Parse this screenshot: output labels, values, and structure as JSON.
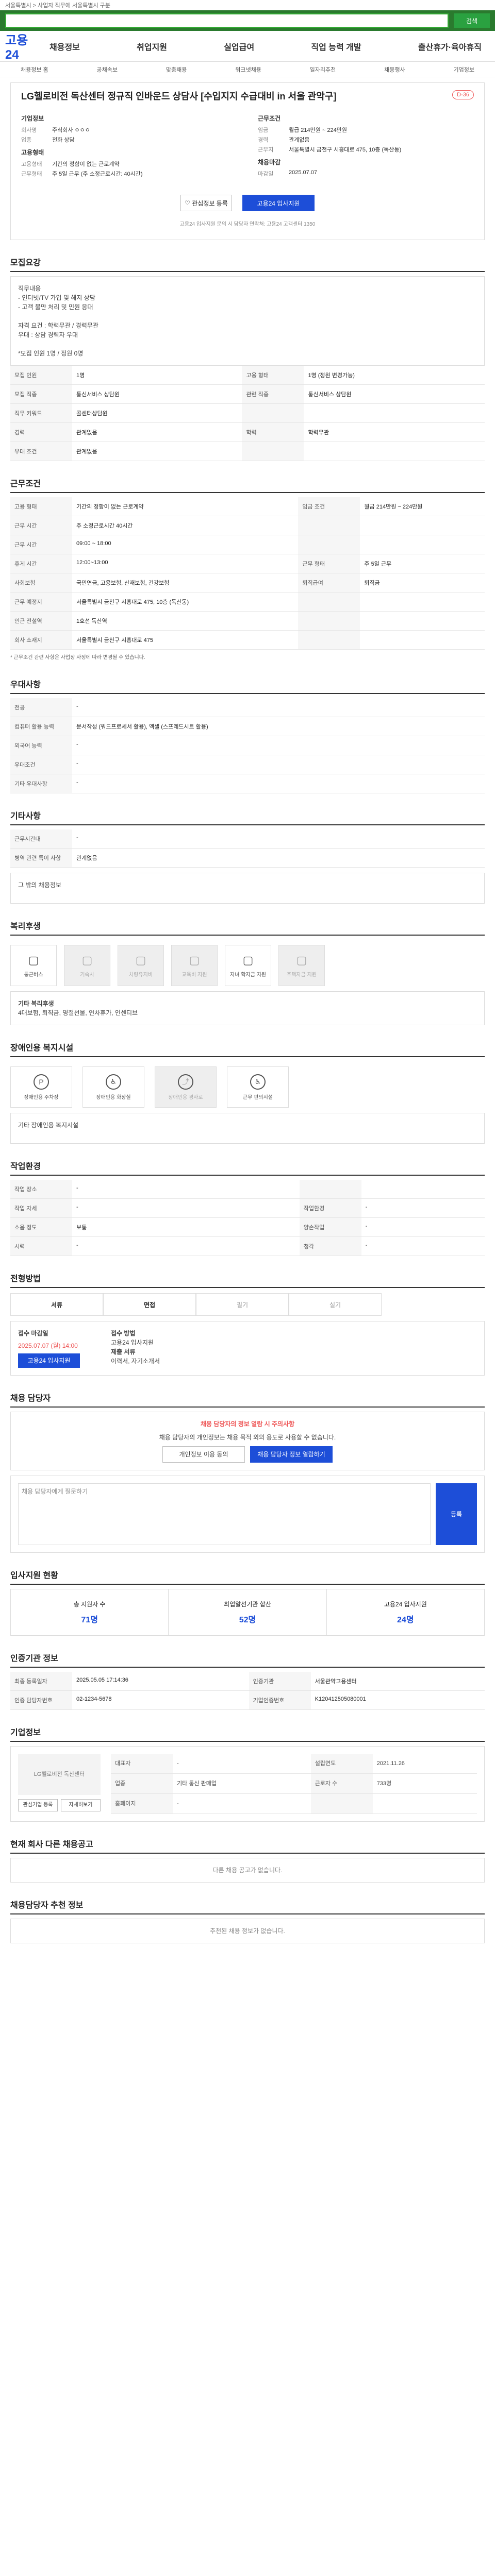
{
  "topbar": {
    "text": "서울특별시 > 사업자 직무에 서울특별시 구분"
  },
  "search": {
    "placeholder": "",
    "button": "검색"
  },
  "logo": "고용24",
  "gnb": [
    "채용정보",
    "취업지원",
    "실업급여",
    "직업 능력 개발",
    "출산휴가·육아휴직"
  ],
  "gnb2": [
    "채용정보 홈",
    "공채속보",
    "맞춤채용",
    "워크넷채용",
    "일자리추천",
    "채용행사",
    "기업정보"
  ],
  "job": {
    "title": "LG헬로비전 독산센터 정규직 인바운드 상담사 [수입지지 수급대비 in 서울 관악구]",
    "dday": "D-36",
    "company_h": "기업정보",
    "company": [
      {
        "k": "회사명",
        "v": "주식회사 ㅇㅇㅇ"
      },
      {
        "k": "업종",
        "v": "전화 상담"
      }
    ],
    "emp_h": "고용형태",
    "emp": [
      {
        "k": "고용형태",
        "v": "기간의 정함이 없는 근로계약"
      },
      {
        "k": "근무형태",
        "v": "주 5일 근무 (주 소정근로시간: 40시간)"
      }
    ],
    "cond_h": "근무조건",
    "cond": [
      {
        "k": "임금",
        "v": "월급 214만원 ~ 224만원"
      },
      {
        "k": "경력",
        "v": "관계없음"
      },
      {
        "k": "근무지",
        "v": "서울특별시 금천구 시흥대로 475, 10층 (독산동)"
      }
    ],
    "apply_h": "채용마감",
    "apply": [
      {
        "k": "마감일",
        "v": "2025.07.07"
      }
    ]
  },
  "buttons": {
    "save": "관심정보 등록",
    "apply": "고용24 입사지원"
  },
  "notice": "고용24 입사지원 문의 시 담당자 연락처: 고용24 고객센터 1350",
  "sec_recruit": {
    "title": "모집요강",
    "body": [
      "직무내용",
      "- 인터넷/TV 가입 및 해지 상담",
      "- 고객 불만 처리 및 민원 응대",
      "",
      "자격 요건 : 학력무관 / 경력무관",
      "우대 : 상담 경력자 우대",
      "",
      "*모집 인원 1명 / 정원 0명"
    ],
    "rows": [
      {
        "k": "모집 인원",
        "v": "1명",
        "k2": "고용 형태",
        "v2": "1명 (정원 변경가능)"
      },
      {
        "k": "모집 직종",
        "v": "통신서비스 상담원",
        "k2": "관련 직종",
        "v2": "통신서비스 상담원"
      },
      {
        "k": "직무 키워드",
        "v": "콜센터상담원",
        "k2": "",
        "v2": ""
      },
      {
        "k": "경력",
        "v": "관계없음",
        "k2": "학력",
        "v2": "학력무관"
      },
      {
        "k": "우대 조건",
        "v": "관계없음",
        "k2": "",
        "v2": ""
      }
    ]
  },
  "sec_work": {
    "title": "근무조건",
    "rows": [
      {
        "k": "고용 형태",
        "v": "기간의 정함이 없는 근로계약",
        "k2": "임금 조건",
        "v2": "월급 214만원 ~ 224만원"
      },
      {
        "k": "근무 시간",
        "v": "주 소정근로시간 40시간",
        "k2": "",
        "v2": ""
      },
      {
        "k": "근무 시간",
        "v": "09:00 ~ 18:00",
        "k2": "",
        "v2": ""
      },
      {
        "k": "휴게 시간",
        "v": "12:00~13:00",
        "k2": "근무 형태",
        "v2": "주 5일 근무"
      },
      {
        "k": "사회보험",
        "v": "국민연금, 고용보험, 산재보험, 건강보험",
        "k2": "퇴직급여",
        "v2": "퇴직금"
      },
      {
        "k": "근무 예정지",
        "v": "서울특별시 금천구 시흥대로 475, 10층 (독산동)",
        "k2": "",
        "v2": ""
      },
      {
        "k": "인근 전철역",
        "v": "1호선 독산역",
        "k2": "",
        "v2": ""
      },
      {
        "k": "회사 소재지",
        "v": "서울특별시 금천구 시흥대로 475",
        "k2": "",
        "v2": ""
      }
    ],
    "note": "* 근무조건 관련 사항은 사업장 사정에 따라 변경될 수 있습니다."
  },
  "sec_welfare": {
    "title": "우대사항",
    "rows": [
      {
        "k": "전공",
        "v": "-"
      },
      {
        "k": "컴퓨터 활용 능력",
        "v": "문서작성 (워드프로세서 활용), 엑셀 (스프레드시트 활용)"
      },
      {
        "k": "외국어 능력",
        "v": "-"
      },
      {
        "k": "우대조건",
        "v": "-"
      },
      {
        "k": "기타 우대사항",
        "v": "-"
      }
    ]
  },
  "sec_etc": {
    "title": "기타사항",
    "rows": [
      {
        "k": "근무시간대",
        "v": "-"
      },
      {
        "k": "병역 관련 특이 사항",
        "v": "관계없음"
      }
    ],
    "extra": "그 밖의 채용정보"
  },
  "sec_benefit": {
    "title": "복리후생",
    "items": [
      {
        "n": "통근버스",
        "on": true
      },
      {
        "n": "기숙사",
        "on": false
      },
      {
        "n": "차량유지비",
        "on": false
      },
      {
        "n": "교육비 지원",
        "on": false
      },
      {
        "n": "자녀 학자금 지원",
        "on": true
      },
      {
        "n": "주택자금 지원",
        "on": false
      }
    ],
    "more_h": "기타 복리후생",
    "more": "4대보험, 퇴직금, 명절선물, 연차휴가, 인센티브"
  },
  "sec_disab": {
    "title": "장애인용 복지시설",
    "items": [
      {
        "n": "장애인용 주차장",
        "on": true
      },
      {
        "n": "장애인용 화장실",
        "on": true
      },
      {
        "n": "장애인용 경사로",
        "on": false
      },
      {
        "n": "근무 편의시설",
        "on": true
      }
    ],
    "more": "기타 장애인용 복지시설"
  },
  "sec_env": {
    "title": "작업환경",
    "rows": [
      {
        "k": "작업 장소",
        "v": "-",
        "k2": "",
        "v2": ""
      },
      {
        "k": "작업 자세",
        "v": "-",
        "k2": "작업환경",
        "v2": "-"
      },
      {
        "k": "소음 정도",
        "v": "보통",
        "k2": "양손작업",
        "v2": "-"
      },
      {
        "k": "시력",
        "v": "-",
        "k2": "청각",
        "v2": "-"
      }
    ]
  },
  "sec_apply": {
    "title": "전형방법",
    "tabs": [
      "서류",
      "면접",
      "필기",
      "실기"
    ],
    "deadline_h": "접수 마감일",
    "deadline": "2025.07.07 (월) 14:00",
    "method_h": "접수 방법",
    "method": "고용24 입사지원",
    "doc_h": "제출 서류",
    "doc": "이력서, 자기소개서",
    "apply_btn": "고용24 입사지원"
  },
  "sec_contact": {
    "title": "채용 담당자",
    "alert": "채용 담당자의 정보 열람 시 주의사항",
    "alert_body": "채용 담당자의 개인정보는 채용 목적 외의 용도로 사용할 수 없습니다.",
    "btns": [
      "개인정보 이용 동의",
      "채용 담당자 정보 열람하기"
    ],
    "qa_h": "채용 담당자에게 질문하기",
    "qa_btn": "등록"
  },
  "sec_stat": {
    "title": "입사지원 현황",
    "items": [
      {
        "n": "총 지원자 수",
        "v": "71명"
      },
      {
        "n": "최업알선기관 합산",
        "v": "52명"
      },
      {
        "n": "고용24 입사지원",
        "v": "24명"
      }
    ]
  },
  "sec_info": {
    "title": "인증기관 정보",
    "rows": [
      {
        "k": "최종 등록일자",
        "v": "2025.05.05 17:14:36",
        "k2": "인증기관",
        "v2": "서울관악고용센터"
      },
      {
        "k": "인증 담당자번호",
        "v": "02-1234-5678",
        "k2": "기업인증번호",
        "v2": "K120412505080001"
      }
    ]
  },
  "sec_company": {
    "title": "기업정보",
    "name": "LG헬로비전 독산센터",
    "rows": [
      {
        "k": "대표자",
        "v": "-",
        "k2": "설립연도",
        "v2": "2021.11.26"
      },
      {
        "k": "업종",
        "v": "기타 통신 판매업",
        "k2": "근로자 수",
        "v2": "733명"
      },
      {
        "k": "홈페이지",
        "v": "-",
        "k2": "",
        "v2": ""
      }
    ],
    "btns": [
      "관심기업 등록",
      "자세히보기"
    ]
  },
  "sec_other": {
    "title": "현재 회사 다른 채용공고",
    "empty": "다른 채용 공고가 없습니다."
  },
  "sec_recommend": {
    "title": "채용담당자 추천 정보",
    "empty": "추천된 채용 정보가 없습니다."
  }
}
